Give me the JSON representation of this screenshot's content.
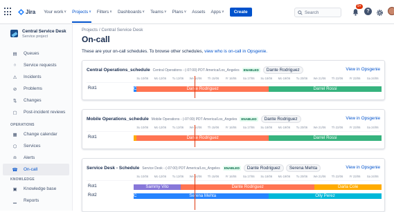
{
  "nav": {
    "logo": "Jira",
    "items": [
      {
        "label": "Your work",
        "chevron": true
      },
      {
        "label": "Projects",
        "chevron": true,
        "active": true
      },
      {
        "label": "Filters",
        "chevron": true
      },
      {
        "label": "Dashboards",
        "chevron": true
      },
      {
        "label": "Teams",
        "chevron": true
      },
      {
        "label": "Plans",
        "chevron": true
      },
      {
        "label": "Assets",
        "chevron": false
      },
      {
        "label": "Apps",
        "chevron": true
      }
    ],
    "create": "Create",
    "search_placeholder": "Search",
    "notification_count": "9+"
  },
  "sidebar": {
    "project_name": "Central Service Desk",
    "project_type": "Service project",
    "items": [
      {
        "label": "Queues",
        "icon": "queues-icon"
      },
      {
        "label": "Service requests",
        "icon": "service-requests-icon"
      },
      {
        "label": "Incidents",
        "icon": "incidents-icon"
      },
      {
        "label": "Problems",
        "icon": "problems-icon"
      },
      {
        "label": "Changes",
        "icon": "changes-icon"
      },
      {
        "label": "Post-incident reviews",
        "icon": "post-incident-reviews-icon"
      }
    ],
    "operations_heading": "OPERATIONS",
    "operations": [
      {
        "label": "Change calendar",
        "icon": "calendar-icon"
      },
      {
        "label": "Services",
        "icon": "services-icon"
      },
      {
        "label": "Alerts",
        "icon": "alerts-icon"
      },
      {
        "label": "On-call",
        "icon": "on-call-icon",
        "active": true
      }
    ],
    "knowledge_heading": "KNOWLEDGE",
    "knowledge": [
      {
        "label": "Knowledge base",
        "icon": "knowledge-base-icon"
      },
      {
        "label": "Reports",
        "icon": "reports-icon"
      }
    ]
  },
  "page": {
    "breadcrumb": "Projects  /  Central Service Desk",
    "title": "On-call",
    "intro_text": "These are your on-call schedules. To browse other schedules, ",
    "intro_link": "view who is on-call in Opsgenie."
  },
  "ticks": [
    "Su 10/06",
    "Mo 12/06",
    "Tu 12/06",
    "We 14/06",
    "Th 15/06",
    "Fr 16/06",
    "Sa 17/06",
    "Su 18/06",
    "Mo 19/06",
    "Tu 20/06",
    "We 21/06",
    "Th 22/06",
    "Fr 23/06",
    "Sa 24/06"
  ],
  "schedules": [
    {
      "name": "Central Operations_schedule",
      "timezone": "Central Operations - (-07:00) PDT America/Los_Angeles",
      "status": "ENABLED",
      "people": [
        "Dante Rodriguez"
      ],
      "view_link": "View in Opsgenie",
      "rows": [
        {
          "label": "Rot1",
          "segments": [
            {
              "name": "C",
              "start": 0.0,
              "end": 0.012,
              "color": "#2684ff"
            },
            {
              "name": "Dante Rodriguez",
              "start": 0.012,
              "end": 0.545,
              "color": "#ff7452"
            },
            {
              "name": "Darrel Rossi",
              "start": 0.545,
              "end": 1.0,
              "color": "#36b37e"
            }
          ]
        }
      ]
    },
    {
      "name": "Mobile Operations_schedule",
      "timezone": "Mobile Operations - (-07:00) PDT America/Los_Angeles",
      "status": "ENABLED",
      "people": [
        "Dante Rodriguez"
      ],
      "view_link": "View in Opsgenie",
      "rows": [
        {
          "label": "Rot1",
          "segments": [
            {
              "name": "",
              "start": 0.0,
              "end": 0.012,
              "color": "#ffab00"
            },
            {
              "name": "Dante Rodriguez",
              "start": 0.012,
              "end": 0.545,
              "color": "#ff7452"
            },
            {
              "name": "Darrel Rossi",
              "start": 0.545,
              "end": 1.0,
              "color": "#36b37e"
            }
          ]
        }
      ]
    },
    {
      "name": "Service Desk - Schedule",
      "timezone": "Service Desk - (-07:00) PDT America/Los_Angeles",
      "status": "ENABLED",
      "people": [
        "Dante Rodriguez",
        "Serena Mehta"
      ],
      "view_link": "View in Opsgenie",
      "rows": [
        {
          "label": "Rot1",
          "segments": [
            {
              "name": "Sammy Vito",
              "start": 0.0,
              "end": 0.19,
              "color": "#8777d9"
            },
            {
              "name": "Dante Rodriguez",
              "start": 0.19,
              "end": 0.73,
              "color": "#ff7452"
            },
            {
              "name": "Darla Cole",
              "start": 0.73,
              "end": 1.0,
              "color": "#ffab00"
            }
          ]
        },
        {
          "label": "Rot2",
          "segments": [
            {
              "name": "C",
              "start": 0.0,
              "end": 0.012,
              "color": "#2684ff"
            },
            {
              "name": "Serena Mehta",
              "start": 0.012,
              "end": 0.545,
              "color": "#2684ff"
            },
            {
              "name": "Olly Perez",
              "start": 0.545,
              "end": 1.0,
              "color": "#00b8d9"
            }
          ]
        }
      ]
    }
  ],
  "now_position": 0.245
}
